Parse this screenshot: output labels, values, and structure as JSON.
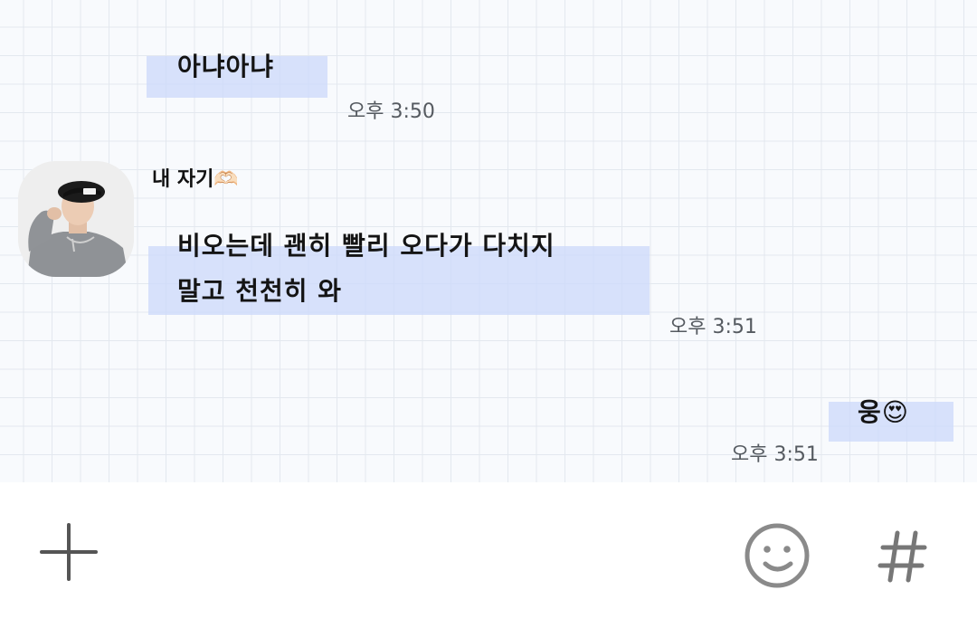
{
  "messages": [
    {
      "text": "아냐아냐",
      "time": "오후 3:50"
    },
    {
      "sender": "내 자기🫶🏻",
      "line1": "비오는데 괜히 빨리 오다가 다치지",
      "line2": "말고 천천히 와",
      "time": "오후 3:51"
    },
    {
      "text": "웅😍",
      "time": "오후 3:51"
    }
  ],
  "input_bar": {
    "add_icon": "plus-icon",
    "emoji_icon": "smiley-icon",
    "hashtag_icon": "hashtag-icon"
  },
  "colors": {
    "highlight": "#cddafa",
    "grid": "#e3e8ef",
    "icon": "#777777"
  }
}
